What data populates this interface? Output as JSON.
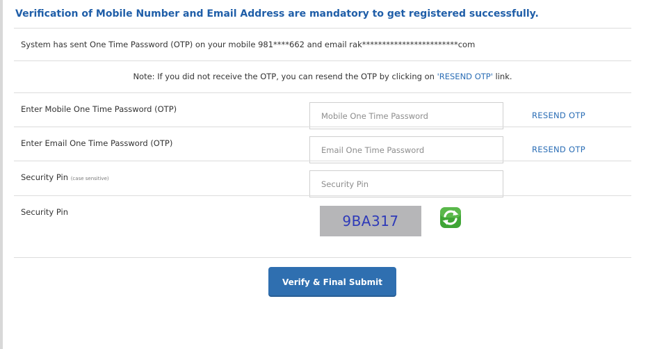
{
  "heading": "Verification of Mobile Number and Email Address are mandatory to get registered successfully.",
  "info_text": "System has sent One Time Password (OTP) on your mobile 981****662 and email rak************************com",
  "note": {
    "prefix": "Note: If you did not receive the OTP,    you can resend the OTP by clicking on ",
    "link": "'RESEND OTP'",
    "suffix": " link."
  },
  "mobile_otp": {
    "label": "Enter Mobile One Time Password (OTP)",
    "placeholder": "Mobile One Time Password",
    "value": "",
    "resend": "RESEND OTP"
  },
  "email_otp": {
    "label": "Enter Email One Time Password (OTP)",
    "placeholder": "Email One Time Password",
    "value": "",
    "resend": "RESEND OTP"
  },
  "security_pin_input": {
    "label": "Security Pin",
    "hint": "(case sensitive)",
    "placeholder": "Security Pin",
    "value": ""
  },
  "captcha": {
    "label": "Security Pin",
    "code": "9BA317",
    "refresh_icon": "refresh-icon"
  },
  "submit_label": "Verify & Final Submit",
  "colors": {
    "heading": "#1f5ea8",
    "link": "#2a6db5",
    "button": "#2f6fb0",
    "captcha_bg": "#b6b6b8",
    "captcha_text": "#2e3ab8",
    "refresh_green": "#3fa535"
  }
}
